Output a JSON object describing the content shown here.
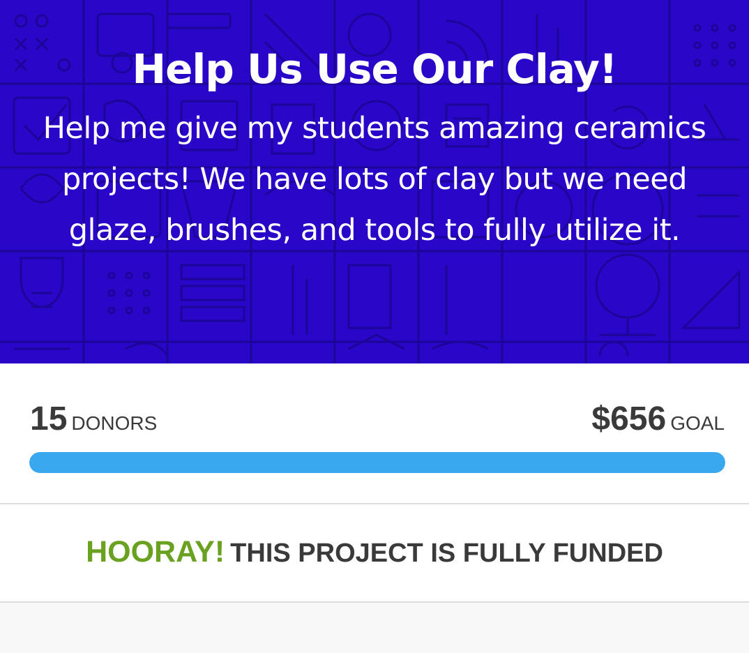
{
  "project": {
    "title": "Help Us Use Our Clay!",
    "description": "Help me give my students amazing ceramics projects! We have lots of clay but we need glaze, brushes, and tools to fully utilize it."
  },
  "stats": {
    "donors_count": "15",
    "donors_label": "DONORS",
    "goal_amount": "$656",
    "goal_label": "GOAL",
    "progress_percent": 100
  },
  "status": {
    "hooray": "HOORAY!",
    "message": "THIS PROJECT IS FULLY FUNDED"
  },
  "colors": {
    "hero_bg": "#2a06c8",
    "progress_fill": "#3aa8ee",
    "hooray_green": "#6aa121"
  }
}
